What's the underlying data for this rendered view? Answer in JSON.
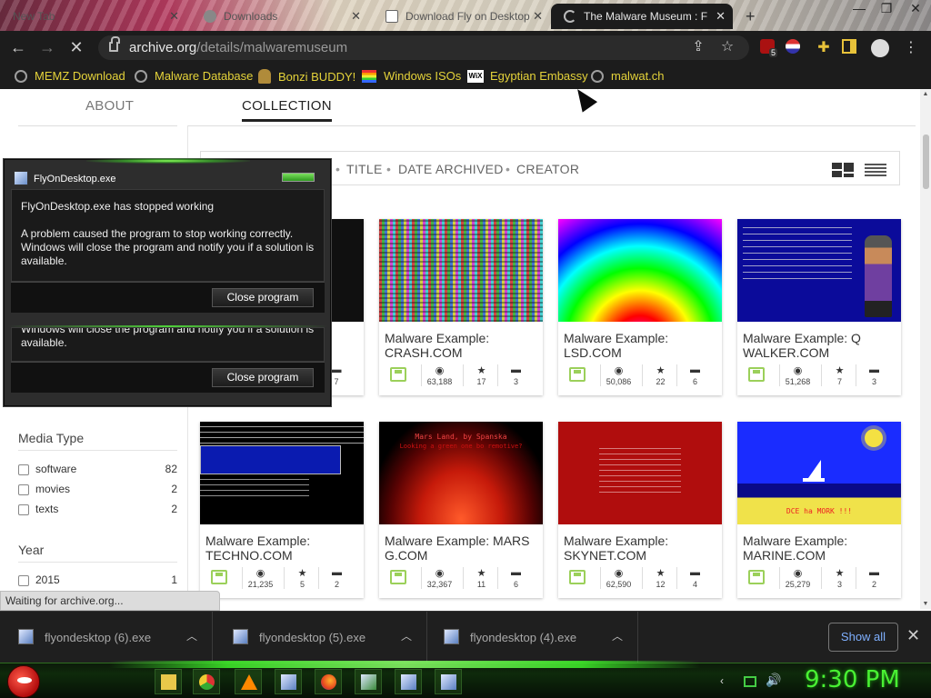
{
  "tabs": [
    {
      "title": "New Tab",
      "active": false
    },
    {
      "title": "Downloads",
      "active": false
    },
    {
      "title": "Download Fly on Desktop",
      "active": false
    },
    {
      "title": "The Malware Museum : F",
      "active": true
    }
  ],
  "new_tab_symbol": "+",
  "window_controls": [
    "—",
    "❐",
    "✕"
  ],
  "omnibox": {
    "domain": "archive.org",
    "path": "/details/malwaremuseum"
  },
  "toolbar": {
    "extension_badge": "5"
  },
  "bookmarks": [
    {
      "label": "MEMZ Download",
      "icon": "globe-icon"
    },
    {
      "label": "Malware Database",
      "icon": "globe-icon"
    },
    {
      "label": "Bonzi BUDDY!",
      "icon": "bonzi-icon"
    },
    {
      "label": "Windows ISOs",
      "icon": "windows-flag-icon"
    },
    {
      "label": "Egyptian Embassy",
      "icon": "wix-icon"
    },
    {
      "label": "malwat.ch",
      "icon": "globe-icon"
    }
  ],
  "page_tabs": {
    "about": "ABOUT",
    "collection": "COLLECTION"
  },
  "sort": {
    "title": "TITLE",
    "date_archived": "DATE ARCHIVED",
    "creator": "CREATOR",
    "separator": "•"
  },
  "cards": [
    {
      "title": "",
      "views": "",
      "favs": "",
      "reviews": "7"
    },
    {
      "title": "Malware Example: CRASH.COM",
      "views": "63,188",
      "favs": "17",
      "reviews": "3"
    },
    {
      "title": "Malware Example: LSD.COM",
      "views": "50,086",
      "favs": "22",
      "reviews": "6"
    },
    {
      "title": "Malware Example: Q WALKER.COM",
      "views": "51,268",
      "favs": "7",
      "reviews": "3"
    },
    {
      "title": "Malware Example: TECHNO.COM",
      "views": "21,235",
      "favs": "5",
      "reviews": "2"
    },
    {
      "title": "Malware Example: MARS G.COM",
      "views": "32,367",
      "favs": "11",
      "reviews": "6"
    },
    {
      "title": "Malware Example: SKYNET.COM",
      "views": "62,590",
      "favs": "12",
      "reviews": "4"
    },
    {
      "title": "Malware Example: MARINE.COM",
      "views": "25,279",
      "favs": "3",
      "reviews": "2"
    }
  ],
  "thumb_texts": {
    "mars": "Mars Land, by Spanska",
    "mars_sub": "Looking a green one bo remotive?",
    "marine": "DCE ha MORK !!!"
  },
  "facets": {
    "media_type": {
      "heading": "Media Type",
      "items": [
        {
          "label": "software",
          "count": "82"
        },
        {
          "label": "movies",
          "count": "2"
        },
        {
          "label": "texts",
          "count": "2"
        }
      ]
    },
    "year": {
      "heading": "Year",
      "items": [
        {
          "label": "2015",
          "count": "1"
        }
      ]
    }
  },
  "status_text": "Waiting for archive.org...",
  "dialog": {
    "title": "FlyOnDesktop.exe",
    "heading": "FlyOnDesktop.exe has stopped working",
    "body": "A problem caused the program to stop working correctly. Windows will close the program and notify you if a solution is available.",
    "ghost_body": "Windows will close the program and notify you if a solution is available.",
    "button": "Close program"
  },
  "downloads": [
    {
      "file": "flyondesktop (6).exe"
    },
    {
      "file": "flyondesktop (5).exe"
    },
    {
      "file": "flyondesktop (4).exe"
    }
  ],
  "show_all": "Show all",
  "clock": "9:30 PM",
  "colors": {
    "bookmark_text": "#e5d33a",
    "clock": "#49f033",
    "accent_link": "#7fb0ff"
  }
}
